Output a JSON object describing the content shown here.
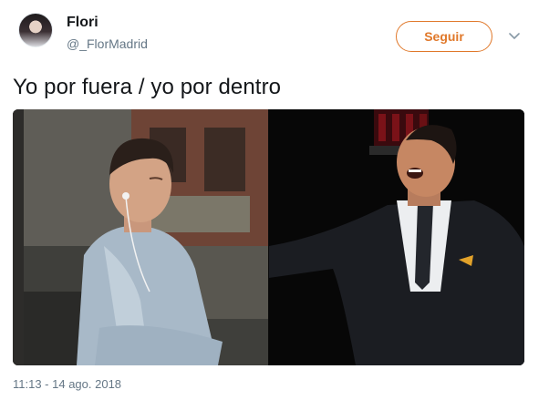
{
  "user": {
    "display_name": "Flori",
    "handle": "@_FlorMadrid"
  },
  "actions": {
    "follow_label": "Seguir",
    "more_icon": "chevron-down-icon"
  },
  "tweet": {
    "text": "Yo por fuera / yo por dentro",
    "timestamp": "11:13 - 14 ago. 2018"
  },
  "colors": {
    "accent": "#e0782a",
    "secondary_text": "#657786",
    "primary_text": "#14171a"
  }
}
